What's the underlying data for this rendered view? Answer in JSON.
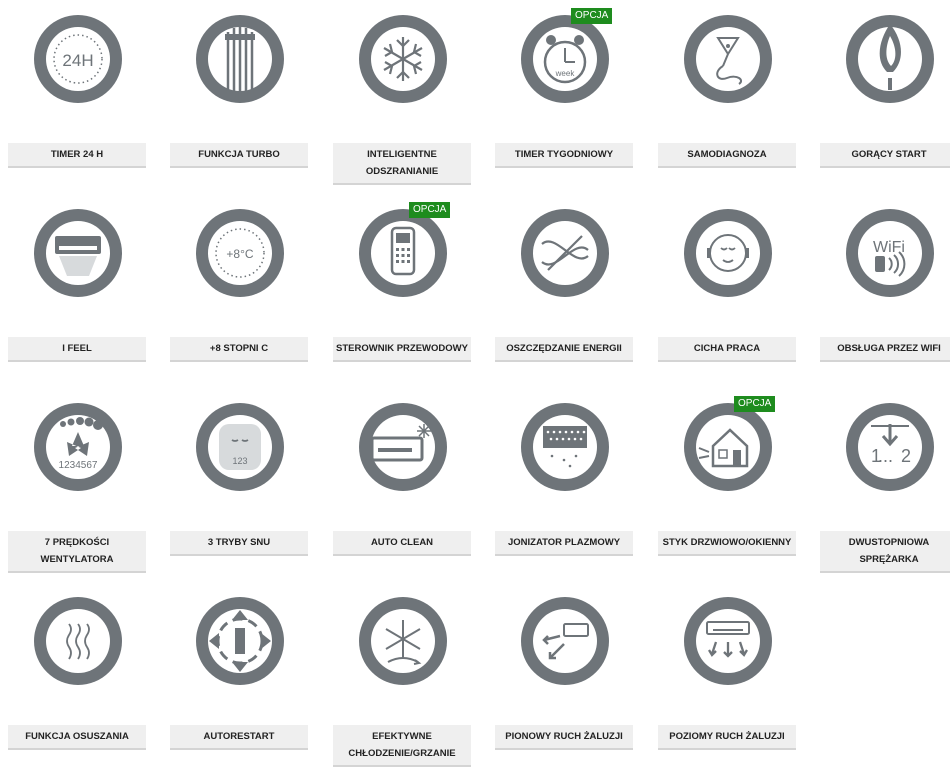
{
  "colors": {
    "ring": "#6e7479",
    "inner": "#ffffff",
    "label_bg": "#efefef",
    "badge": "#1e8c1e"
  },
  "badge_text": "OPCJA",
  "features": [
    {
      "label": "TIMER 24 H",
      "icon": "timer-24h-icon",
      "optional": false
    },
    {
      "label": "FUNKCJA TURBO",
      "icon": "turbo-icon",
      "optional": false
    },
    {
      "label": "INTELIGENTNE ODSZRANIANIE",
      "icon": "snowflake-defrost-icon",
      "optional": false
    },
    {
      "label": "TIMER TYGODNIOWY",
      "icon": "weekly-timer-icon",
      "optional": true
    },
    {
      "label": "SAMODIAGNOZA",
      "icon": "self-diagnosis-icon",
      "optional": false
    },
    {
      "label": "GORĄCY START",
      "icon": "hot-start-icon",
      "optional": false
    },
    {
      "label": "I FEEL",
      "icon": "i-feel-icon",
      "optional": false
    },
    {
      "label": "+8 STOPNI C",
      "icon": "plus-8-degrees-icon",
      "optional": false
    },
    {
      "label": "STEROWNIK PRZEWODOWY",
      "icon": "wired-controller-icon",
      "optional": true
    },
    {
      "label": "OSZCZĘDZANIE ENERGII",
      "icon": "energy-saving-icon",
      "optional": false
    },
    {
      "label": "CICHA PRACA",
      "icon": "quiet-operation-icon",
      "optional": false
    },
    {
      "label": "OBSŁUGA PRZEZ WIFI",
      "icon": "wifi-icon",
      "optional": false
    },
    {
      "label": "7 PRĘDKOŚCI WENTYLATORA",
      "icon": "fan-speeds-icon",
      "optional": false
    },
    {
      "label": "3 TRYBY SNU",
      "icon": "sleep-modes-icon",
      "optional": false
    },
    {
      "label": "AUTO CLEAN",
      "icon": "auto-clean-icon",
      "optional": false
    },
    {
      "label": "JONIZATOR PLAZMOWY",
      "icon": "plasma-ionizer-icon",
      "optional": false
    },
    {
      "label": "STYK DRZWIOWO/OKIENNY",
      "icon": "door-window-contact-icon",
      "optional": true
    },
    {
      "label": "DWUSTOPNIOWA SPRĘŻARKA",
      "icon": "two-stage-compressor-icon",
      "optional": false
    },
    {
      "label": "FUNKCJA OSUSZANIA",
      "icon": "drying-icon",
      "optional": false
    },
    {
      "label": "AUTORESTART",
      "icon": "autorestart-icon",
      "optional": false
    },
    {
      "label": "EFEKTYWNE CHŁODZENIE/GRZANIE",
      "icon": "cooling-heating-icon",
      "optional": false
    },
    {
      "label": "PIONOWY RUCH ŻALUZJI",
      "icon": "vertical-louver-icon",
      "optional": false
    },
    {
      "label": "POZIOMY RUCH ŻALUZJI",
      "icon": "horizontal-louver-icon",
      "optional": false
    }
  ],
  "icon_texts": {
    "timer": "24H",
    "week": "week",
    "plus8": "+8°C",
    "sleep": "123",
    "wifi": "WiFi",
    "fan": "1234567",
    "compressor_1": "1",
    "compressor_2": "2"
  }
}
